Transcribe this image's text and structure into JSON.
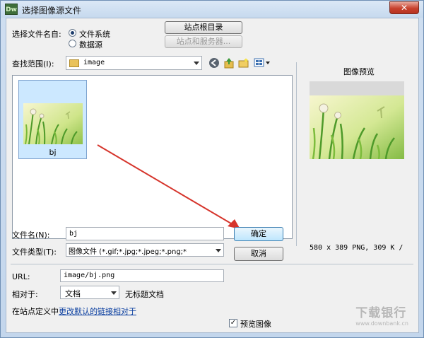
{
  "window": {
    "app_icon": "Dw",
    "title": "选择图像源文件",
    "close_glyph": "✕"
  },
  "source": {
    "label": "选择文件名自:",
    "options": [
      {
        "label": "文件系统",
        "selected": true
      },
      {
        "label": "数据源",
        "selected": false
      }
    ],
    "site_root_button": "站点根目录",
    "site_server_button": "站点和服务器..."
  },
  "lookin": {
    "label": "查找范围(I):",
    "folder": "image",
    "icons": [
      "back-icon",
      "up-folder-icon",
      "new-folder-icon",
      "view-menu-icon"
    ]
  },
  "files": [
    {
      "name": "bj",
      "selected": true
    }
  ],
  "filename": {
    "label": "文件名(N):",
    "value": "bj",
    "ok_button": "确定"
  },
  "filetype": {
    "label": "文件类型(T):",
    "value": "图像文件 (*.gif;*.jpg;*.jpeg;*.png;*",
    "cancel_button": "取消"
  },
  "url": {
    "label": "URL:",
    "value": "image/bj.png"
  },
  "relative": {
    "label": "相对于:",
    "value": "文档",
    "doc_name": "无标题文档"
  },
  "site_def": {
    "prefix": "在站点定义中",
    "link": "更改默认的链接相对于"
  },
  "preview": {
    "title": "图像预览",
    "info": "580 x 389 PNG, 309 K /",
    "checkbox_label": "预览图像",
    "checked": true,
    "check_glyph": "✓"
  },
  "watermark": {
    "brand": "下载银行",
    "url": "www.downbank.cn"
  },
  "colors": {
    "arrow": "#d6352c",
    "link": "#0b3fa0"
  }
}
